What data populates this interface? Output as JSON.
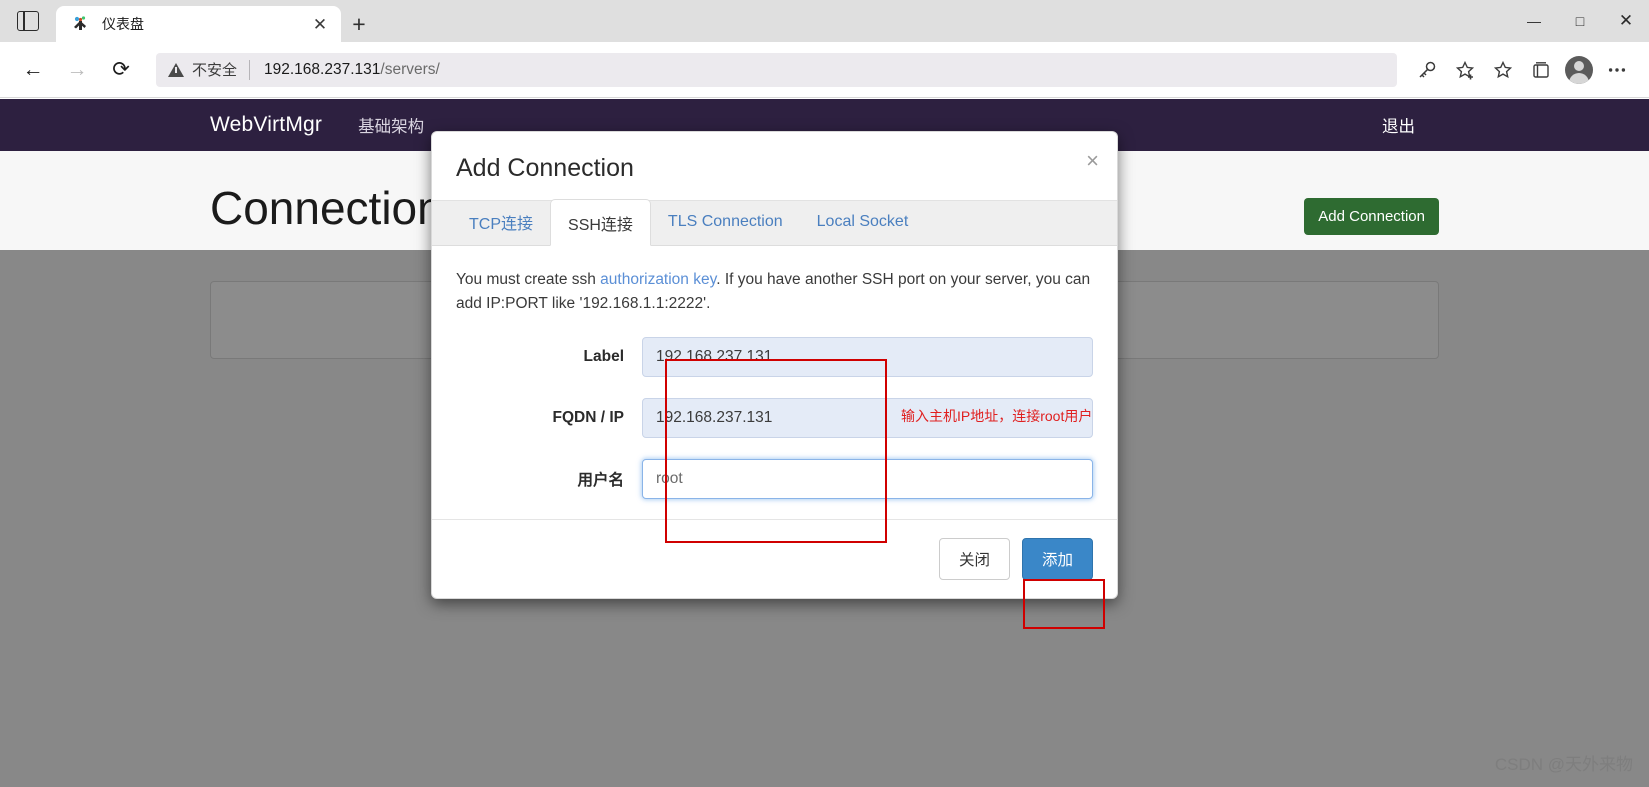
{
  "browser": {
    "tab": {
      "title": "仪表盘",
      "close_label": "✕"
    },
    "new_tab_label": "+",
    "window_controls": {
      "minimize": "—",
      "maximize": "□",
      "close": "✕"
    },
    "nav": {
      "back": "←",
      "forward": "→",
      "reload": "⟳"
    },
    "omnibox": {
      "security_label": "不安全",
      "url_host": "192.168.237.131",
      "url_path": "/servers/"
    },
    "toolbar_icons": [
      "key-icon",
      "collections-add-icon",
      "favorites-icon",
      "collections-icon",
      "profile-icon",
      "settings-more-icon"
    ]
  },
  "site": {
    "brand": "WebVirtMgr",
    "nav_items": [
      {
        "label": "基础架构"
      }
    ],
    "logout_label": "退出",
    "page_title": "Connections",
    "add_connection_button": "Add Connection"
  },
  "modal": {
    "title": "Add Connection",
    "close_label": "×",
    "tabs": [
      {
        "label": "TCP连接",
        "active": false
      },
      {
        "label": "SSH连接",
        "active": true
      },
      {
        "label": "TLS Connection",
        "active": false
      },
      {
        "label": "Local Socket",
        "active": false
      }
    ],
    "help": {
      "part1": "You must create ssh ",
      "link": "authorization key",
      "part2": ". If you have another SSH port on your server, you can add IP:PORT like '192.168.1.1:2222'."
    },
    "fields": [
      {
        "label": "Label",
        "value": "192.168.237.131",
        "focused": false
      },
      {
        "label": "FQDN / IP",
        "value": "192.168.237.131",
        "focused": false
      },
      {
        "label": "用户名",
        "value": "root",
        "focused": true
      }
    ],
    "footer": {
      "close_button": "关闭",
      "add_button": "添加"
    }
  },
  "annotations": {
    "note_text": "输入主机IP地址，连接root用户",
    "color": "#e02020"
  },
  "watermark": "CSDN @天外来物"
}
